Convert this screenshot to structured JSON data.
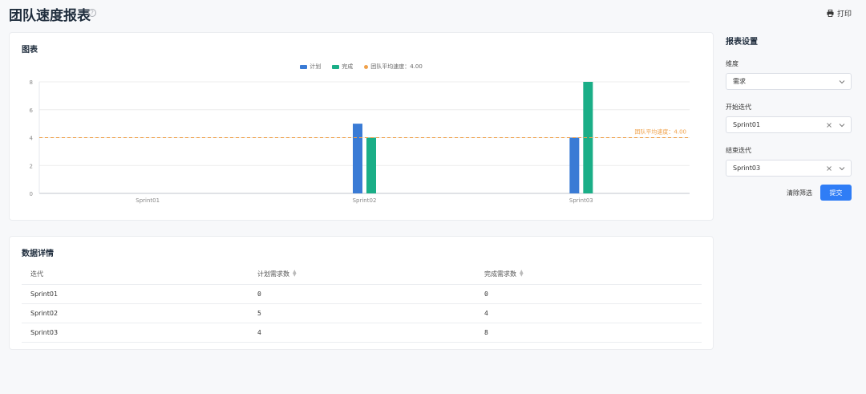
{
  "header": {
    "title": "团队速度报表",
    "help_icon": "question-circle-icon",
    "print_label": "打印",
    "print_icon": "printer-icon"
  },
  "chart_card": {
    "title": "图表"
  },
  "chart_data": {
    "type": "bar",
    "categories": [
      "Sprint01",
      "Sprint02",
      "Sprint03"
    ],
    "series": [
      {
        "name": "计划",
        "values": [
          0,
          5,
          4
        ],
        "color": "#3a7bd5"
      },
      {
        "name": "完成",
        "values": [
          0,
          4,
          8
        ],
        "color": "#1aae87"
      }
    ],
    "reference_line": {
      "name": "团队平均速度",
      "label": "团队平均速度：4.00",
      "value": 4.0,
      "color": "#f0a14a"
    },
    "ylim": [
      0,
      8
    ],
    "yticks": [
      0,
      2,
      4,
      6,
      8
    ],
    "grid": true,
    "legend_position": "top-center"
  },
  "table_card": {
    "title": "数据详情",
    "columns": [
      "迭代",
      "计划需求数",
      "完成需求数"
    ],
    "rows": [
      [
        "Sprint01",
        "0",
        "0"
      ],
      [
        "Sprint02",
        "5",
        "4"
      ],
      [
        "Sprint03",
        "4",
        "8"
      ]
    ]
  },
  "settings": {
    "title": "报表设置",
    "dimension_label": "维度",
    "dimension_value": "需求",
    "start_label": "开始迭代",
    "start_value": "Sprint01",
    "end_label": "结束迭代",
    "end_value": "Sprint03",
    "clear_label": "清除筛选",
    "submit_label": "提交"
  }
}
